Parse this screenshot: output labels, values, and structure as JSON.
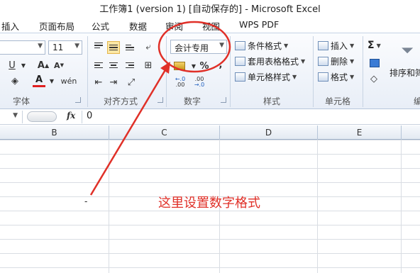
{
  "window": {
    "title": "工作簿1 (version 1) [自动保存的] - Microsoft Excel"
  },
  "tabs": [
    "插入",
    "页面布局",
    "公式",
    "数据",
    "审阅",
    "视图",
    "WPS PDF"
  ],
  "font": {
    "size": "11",
    "color_letter": "A",
    "group_label": "字体"
  },
  "alignment": {
    "group_label": "对齐方式"
  },
  "number": {
    "format_value": "会计专用",
    "percent": "%",
    "comma": ",",
    "group_label": "数字"
  },
  "styles": {
    "conditional": "条件格式",
    "table_format": "套用表格格式",
    "cell_styles": "单元格样式",
    "group_label": "样式"
  },
  "cells": {
    "insert": "插入",
    "delete": "删除",
    "format": "格式",
    "group_label": "单元格"
  },
  "editing": {
    "sum": "Σ",
    "sort_filter": "排序和筛",
    "group_label": "编"
  },
  "formula_bar": {
    "fx": "fx",
    "value": "0"
  },
  "columns": [
    "B",
    "C",
    "D",
    "E"
  ],
  "cell_value": "-",
  "annotation": {
    "text": "这里设置数字格式",
    "color": "#e03028"
  },
  "colors": {
    "highlight": "#fde7a5",
    "annotation_red": "#e03028"
  }
}
